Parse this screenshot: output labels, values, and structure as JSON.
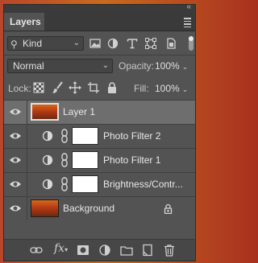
{
  "panel": {
    "tab_label": "Layers",
    "collapse_chevron": "«",
    "close_glyph": "×"
  },
  "filter": {
    "kind_label": "Kind",
    "icons": [
      "image-filter-icon",
      "adjustment-filter-icon",
      "type-filter-icon",
      "shape-filter-icon",
      "smart-object-filter-icon"
    ]
  },
  "blend": {
    "mode": "Normal",
    "opacity_label": "Opacity:",
    "opacity_value": "100%"
  },
  "lock": {
    "label": "Lock:",
    "fill_label": "Fill:",
    "fill_value": "100%"
  },
  "layers": [
    {
      "name": "Layer 1",
      "type": "image",
      "selected": true,
      "visible": true
    },
    {
      "name": "Photo Filter 2",
      "type": "adjustment",
      "selected": false,
      "visible": true
    },
    {
      "name": "Photo Filter 1",
      "type": "adjustment",
      "selected": false,
      "visible": true
    },
    {
      "name": "Brightness/Contr...",
      "type": "adjustment",
      "selected": false,
      "visible": true
    },
    {
      "name": "Background",
      "type": "image",
      "selected": false,
      "visible": true,
      "locked": true
    }
  ],
  "bottom": {
    "fx_label": "fx"
  },
  "colors": {
    "panel_bg": "#535353",
    "selected_row": "#6e6e6e",
    "tab_bar": "#3a3a3a"
  }
}
